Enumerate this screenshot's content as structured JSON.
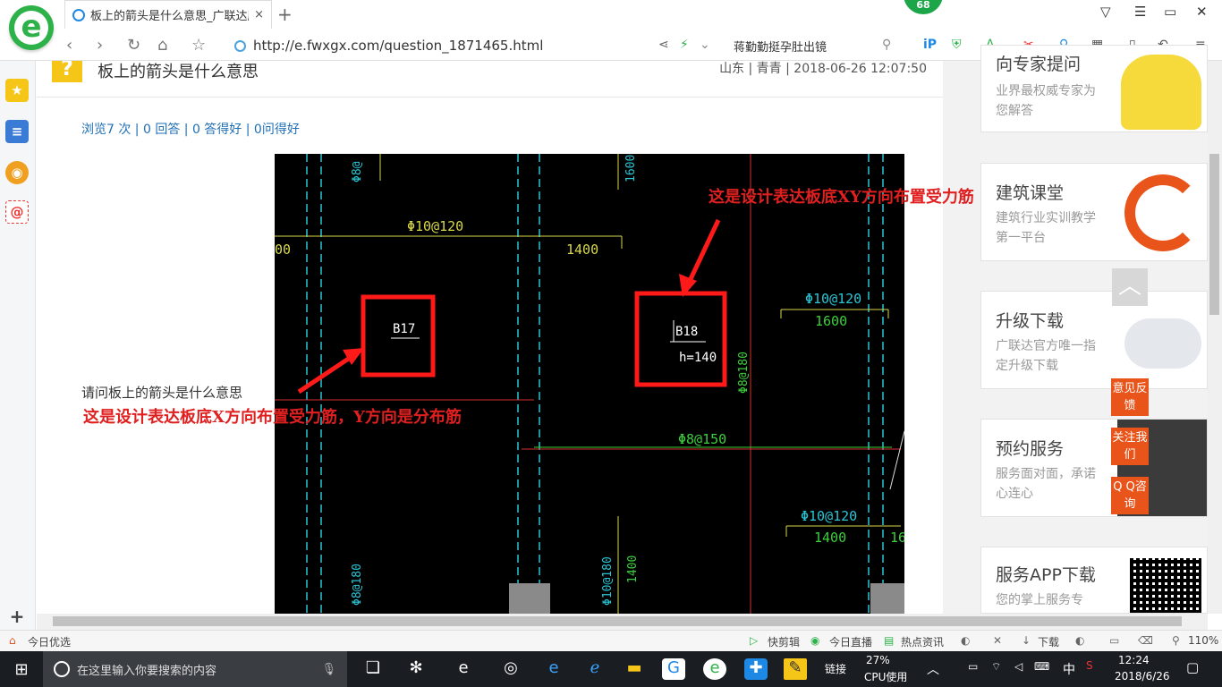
{
  "browser": {
    "tab_title": "板上的箭头是什么意思_广联达服",
    "tab_close": "×",
    "new_tab": "+",
    "badge": "68",
    "url": "http://e.fwxgx.com/question_1871465.html",
    "search_value": "蒋勤勤挺孕肚出镜",
    "zoom": "110%"
  },
  "question": {
    "title": "板上的箭头是什么意思",
    "meta": "山东 | 青青 | 2018-06-26 12:07:50",
    "stats": "浏览7 次 | 0 回答 | 0 答得好 | 0问得好",
    "body": "请问板上的箭头是什么意思",
    "annotation_x": "这是设计表达板底X方向布置受力筋，Y方向是分布筋",
    "annotation_xy": "这是设计表达板底XY方向布置受力筋"
  },
  "cad": {
    "labels": {
      "phi10_120_a": "Φ10@120",
      "n1400_a": "1400",
      "n00": "00",
      "b17": "B17",
      "b18": "B18",
      "h140": "h=140",
      "phi10_120_b": "Φ10@120",
      "n1600": "1600",
      "phi8_180_v": "Φ8@180",
      "phi8_150": "Φ8@150",
      "phi10_120_c": "Φ10@120",
      "n1400_b": "1400",
      "n16": "16",
      "phi8_180_v2": "Φ8@180",
      "phi10_180_v": "Φ10@180",
      "n1400_v": "1400",
      "top_v1": "Φ8@",
      "top_v2": "1600"
    }
  },
  "sidebar_cards": [
    {
      "title": "向专家提问",
      "sub": "业界最权威专家为您解答"
    },
    {
      "title": "建筑课堂",
      "sub": "建筑行业实训教学第一平台"
    },
    {
      "title": "升级下载",
      "sub": "广联达官方唯一指定升级下载"
    },
    {
      "title": "预约服务",
      "sub": "服务面对面，承诺心连心"
    },
    {
      "title": "服务APP下载",
      "sub": "您的掌上服务专"
    }
  ],
  "side_buttons": {
    "feedback": "意见反馈",
    "follow": "关注我们",
    "qq": "Q Q咨询"
  },
  "statusbar": {
    "today": "今日优选",
    "kuaijianji": "快剪辑",
    "live": "今日直播",
    "news": "热点资讯",
    "download": "下载"
  },
  "taskbar": {
    "search_placeholder": "在这里输入你要搜索的内容",
    "link": "链接",
    "cpu_pct": "27%",
    "cpu_label": "CPU使用",
    "ime": "中",
    "time": "12:24",
    "date": "2018/6/26"
  },
  "colors": {
    "accent_green": "#2db24a",
    "annotation_red": "#e02020",
    "link_blue": "#1f6fb5",
    "side_orange": "#e8541a"
  }
}
